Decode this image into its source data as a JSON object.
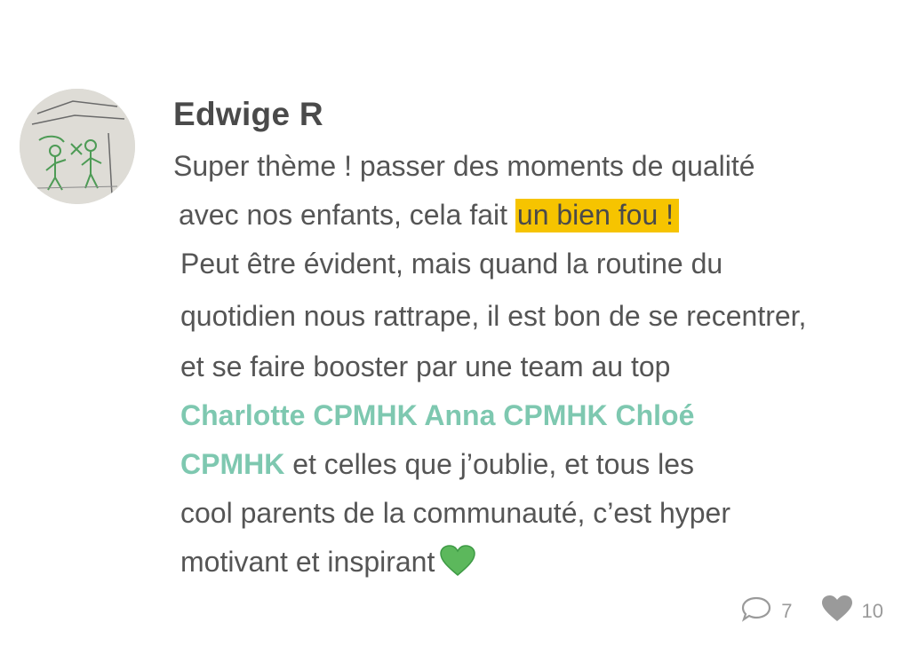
{
  "post": {
    "author": "Edwige R",
    "avatar_label": "avatar-drawing",
    "lines": {
      "l1": "Super thème ! passer des moments de qualité",
      "l2_prefix": "avec nos enfants, cela fait ",
      "l2_highlight": "un bien fou !",
      "l3": "Peut être évident, mais quand la routine du",
      "l4": "quotidien nous rattrape, il est bon de se recentrer,",
      "l5": "et se faire booster par une team au top",
      "l6_mentions": "Charlotte CPMHK Anna CPMHK Chloé",
      "l7_mention": "CPMHK",
      "l7_rest": " et celles que j’oublie, et tous les",
      "l8": "cool parents de la communauté, c’est hyper",
      "l9": "motivant et inspirant"
    },
    "emoji": "green-heart",
    "stats": {
      "comments": "7",
      "likes": "10"
    }
  },
  "colors": {
    "highlight": "#f6c400",
    "mention": "#7ec8b0",
    "text": "#555555",
    "author": "#4a4a4a",
    "icon": "#9a9a9a",
    "heart_emoji": "#5cb85c"
  }
}
